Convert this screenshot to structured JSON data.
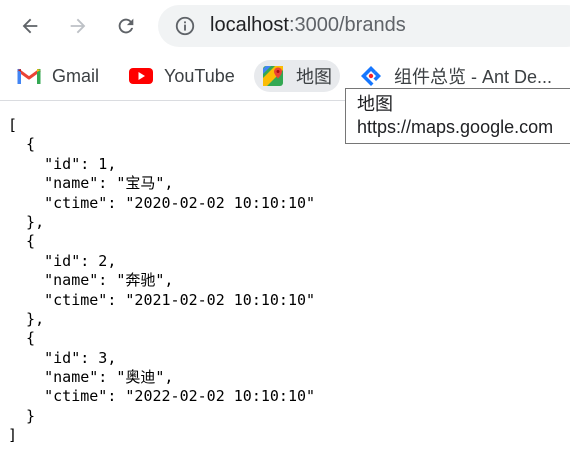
{
  "browser": {
    "url_host": "localhost",
    "url_path": ":3000/brands"
  },
  "bookmarks": [
    {
      "label": "Gmail",
      "icon": "gmail-icon"
    },
    {
      "label": "YouTube",
      "icon": "youtube-icon"
    },
    {
      "label": "地图",
      "icon": "maps-icon"
    },
    {
      "label": "组件总览 - Ant De...",
      "icon": "ant-design-icon"
    }
  ],
  "tooltip": {
    "title": "地图",
    "url": "https://maps.google.com"
  },
  "json_lines": [
    "[",
    "  {",
    "    \"id\": 1,",
    "    \"name\": \"宝马\",",
    "    \"ctime\": \"2020-02-02 10:10:10\"",
    "  },",
    "  {",
    "    \"id\": 2,",
    "    \"name\": \"奔驰\",",
    "    \"ctime\": \"2021-02-02 10:10:10\"",
    "  },",
    "  {",
    "    \"id\": 3,",
    "    \"name\": \"奥迪\",",
    "    \"ctime\": \"2022-02-02 10:10:10\"",
    "  }",
    "]"
  ],
  "colors": {
    "icon_gray": "#5f6368",
    "icon_disabled": "#bdc1c6",
    "omnibox_bg": "#f1f3f4",
    "youtube_red": "#ff0000"
  }
}
